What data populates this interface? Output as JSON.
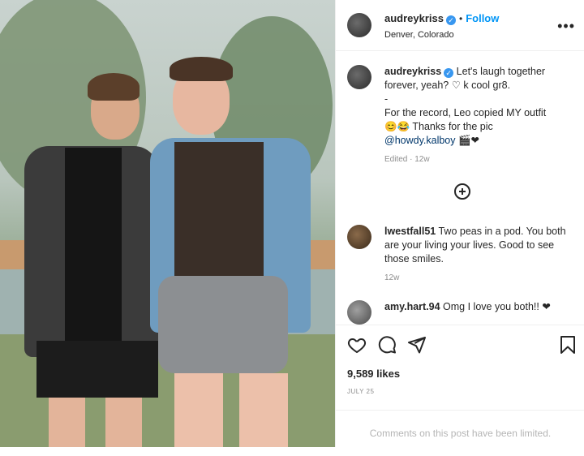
{
  "post": {
    "username": "audreykriss",
    "follow_label": "Follow",
    "location": "Denver, Colorado",
    "more_label": "•••"
  },
  "caption": {
    "username": "audreykriss",
    "line1": "Let's laugh together forever, yeah? ♡ k cool gr8.",
    "dash": "-",
    "line2": "For the record, Leo copied MY outfit",
    "line3": "😊😂 Thanks for the pic",
    "mention": "@howdy.kalboy",
    "mention_suffix": " 🎬❤",
    "meta": "Edited · 12w"
  },
  "comments": [
    {
      "username": "lwestfall51",
      "text": "Two peas in a pod. You both are your living your lives. Good to see those smiles.",
      "meta": "12w"
    },
    {
      "username": "amy.hart.94",
      "text": "Omg I love you both!! ❤"
    }
  ],
  "actions": {
    "likes": "9,589 likes",
    "date": "JULY 25"
  },
  "footer": {
    "limited_text": "Comments on this post have been limited."
  },
  "colors": {
    "link": "#0095f6",
    "verified": "#3897f0",
    "heart": "#ed4956"
  }
}
